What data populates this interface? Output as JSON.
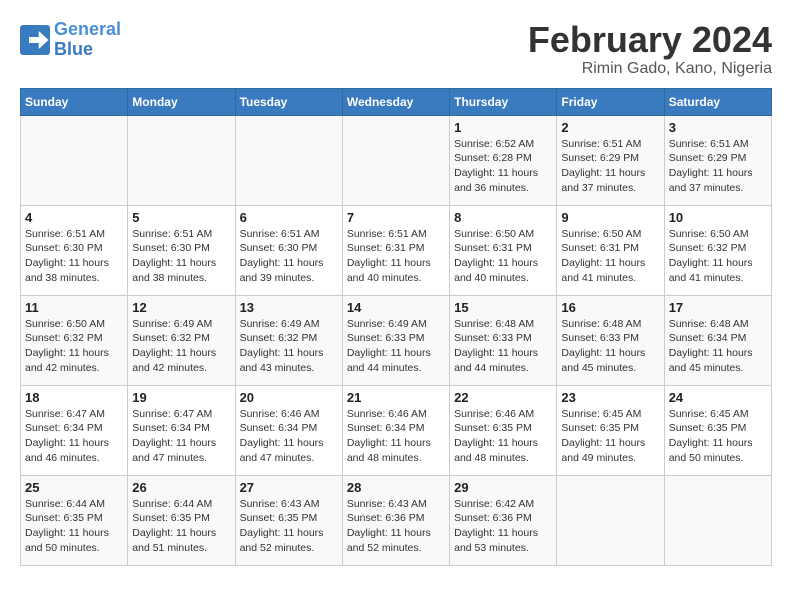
{
  "header": {
    "logo_line1": "General",
    "logo_line2": "Blue",
    "month_year": "February 2024",
    "location": "Rimin Gado, Kano, Nigeria"
  },
  "days_of_week": [
    "Sunday",
    "Monday",
    "Tuesday",
    "Wednesday",
    "Thursday",
    "Friday",
    "Saturday"
  ],
  "weeks": [
    [
      {
        "day": "",
        "info": ""
      },
      {
        "day": "",
        "info": ""
      },
      {
        "day": "",
        "info": ""
      },
      {
        "day": "",
        "info": ""
      },
      {
        "day": "1",
        "info": "Sunrise: 6:52 AM\nSunset: 6:28 PM\nDaylight: 11 hours\nand 36 minutes."
      },
      {
        "day": "2",
        "info": "Sunrise: 6:51 AM\nSunset: 6:29 PM\nDaylight: 11 hours\nand 37 minutes."
      },
      {
        "day": "3",
        "info": "Sunrise: 6:51 AM\nSunset: 6:29 PM\nDaylight: 11 hours\nand 37 minutes."
      }
    ],
    [
      {
        "day": "4",
        "info": "Sunrise: 6:51 AM\nSunset: 6:30 PM\nDaylight: 11 hours\nand 38 minutes."
      },
      {
        "day": "5",
        "info": "Sunrise: 6:51 AM\nSunset: 6:30 PM\nDaylight: 11 hours\nand 38 minutes."
      },
      {
        "day": "6",
        "info": "Sunrise: 6:51 AM\nSunset: 6:30 PM\nDaylight: 11 hours\nand 39 minutes."
      },
      {
        "day": "7",
        "info": "Sunrise: 6:51 AM\nSunset: 6:31 PM\nDaylight: 11 hours\nand 40 minutes."
      },
      {
        "day": "8",
        "info": "Sunrise: 6:50 AM\nSunset: 6:31 PM\nDaylight: 11 hours\nand 40 minutes."
      },
      {
        "day": "9",
        "info": "Sunrise: 6:50 AM\nSunset: 6:31 PM\nDaylight: 11 hours\nand 41 minutes."
      },
      {
        "day": "10",
        "info": "Sunrise: 6:50 AM\nSunset: 6:32 PM\nDaylight: 11 hours\nand 41 minutes."
      }
    ],
    [
      {
        "day": "11",
        "info": "Sunrise: 6:50 AM\nSunset: 6:32 PM\nDaylight: 11 hours\nand 42 minutes."
      },
      {
        "day": "12",
        "info": "Sunrise: 6:49 AM\nSunset: 6:32 PM\nDaylight: 11 hours\nand 42 minutes."
      },
      {
        "day": "13",
        "info": "Sunrise: 6:49 AM\nSunset: 6:32 PM\nDaylight: 11 hours\nand 43 minutes."
      },
      {
        "day": "14",
        "info": "Sunrise: 6:49 AM\nSunset: 6:33 PM\nDaylight: 11 hours\nand 44 minutes."
      },
      {
        "day": "15",
        "info": "Sunrise: 6:48 AM\nSunset: 6:33 PM\nDaylight: 11 hours\nand 44 minutes."
      },
      {
        "day": "16",
        "info": "Sunrise: 6:48 AM\nSunset: 6:33 PM\nDaylight: 11 hours\nand 45 minutes."
      },
      {
        "day": "17",
        "info": "Sunrise: 6:48 AM\nSunset: 6:34 PM\nDaylight: 11 hours\nand 45 minutes."
      }
    ],
    [
      {
        "day": "18",
        "info": "Sunrise: 6:47 AM\nSunset: 6:34 PM\nDaylight: 11 hours\nand 46 minutes."
      },
      {
        "day": "19",
        "info": "Sunrise: 6:47 AM\nSunset: 6:34 PM\nDaylight: 11 hours\nand 47 minutes."
      },
      {
        "day": "20",
        "info": "Sunrise: 6:46 AM\nSunset: 6:34 PM\nDaylight: 11 hours\nand 47 minutes."
      },
      {
        "day": "21",
        "info": "Sunrise: 6:46 AM\nSunset: 6:34 PM\nDaylight: 11 hours\nand 48 minutes."
      },
      {
        "day": "22",
        "info": "Sunrise: 6:46 AM\nSunset: 6:35 PM\nDaylight: 11 hours\nand 48 minutes."
      },
      {
        "day": "23",
        "info": "Sunrise: 6:45 AM\nSunset: 6:35 PM\nDaylight: 11 hours\nand 49 minutes."
      },
      {
        "day": "24",
        "info": "Sunrise: 6:45 AM\nSunset: 6:35 PM\nDaylight: 11 hours\nand 50 minutes."
      }
    ],
    [
      {
        "day": "25",
        "info": "Sunrise: 6:44 AM\nSunset: 6:35 PM\nDaylight: 11 hours\nand 50 minutes."
      },
      {
        "day": "26",
        "info": "Sunrise: 6:44 AM\nSunset: 6:35 PM\nDaylight: 11 hours\nand 51 minutes."
      },
      {
        "day": "27",
        "info": "Sunrise: 6:43 AM\nSunset: 6:35 PM\nDaylight: 11 hours\nand 52 minutes."
      },
      {
        "day": "28",
        "info": "Sunrise: 6:43 AM\nSunset: 6:36 PM\nDaylight: 11 hours\nand 52 minutes."
      },
      {
        "day": "29",
        "info": "Sunrise: 6:42 AM\nSunset: 6:36 PM\nDaylight: 11 hours\nand 53 minutes."
      },
      {
        "day": "",
        "info": ""
      },
      {
        "day": "",
        "info": ""
      }
    ]
  ]
}
